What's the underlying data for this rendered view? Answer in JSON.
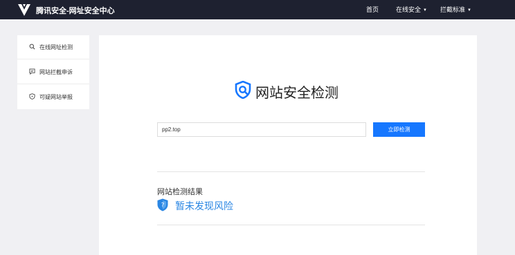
{
  "header": {
    "brand": "腾讯安全-网址安全中心",
    "nav": {
      "home": "首页",
      "online_security": "在线安全",
      "block_standard": "拦截标准"
    }
  },
  "sidebar": {
    "items": [
      {
        "label": "在线网址检测",
        "icon": "search-icon"
      },
      {
        "label": "网站拦截申诉",
        "icon": "message-icon"
      },
      {
        "label": "可疑网站举报",
        "icon": "shield-icon"
      }
    ]
  },
  "main": {
    "title": "网站安全检测",
    "input_value": "pp2.top",
    "check_button": "立即检测",
    "result_label": "网站检测结果",
    "result_text": "暂未发现风险"
  },
  "colors": {
    "topbar": "#1e2130",
    "accent": "#1677ff",
    "result": "#2a86e3"
  }
}
